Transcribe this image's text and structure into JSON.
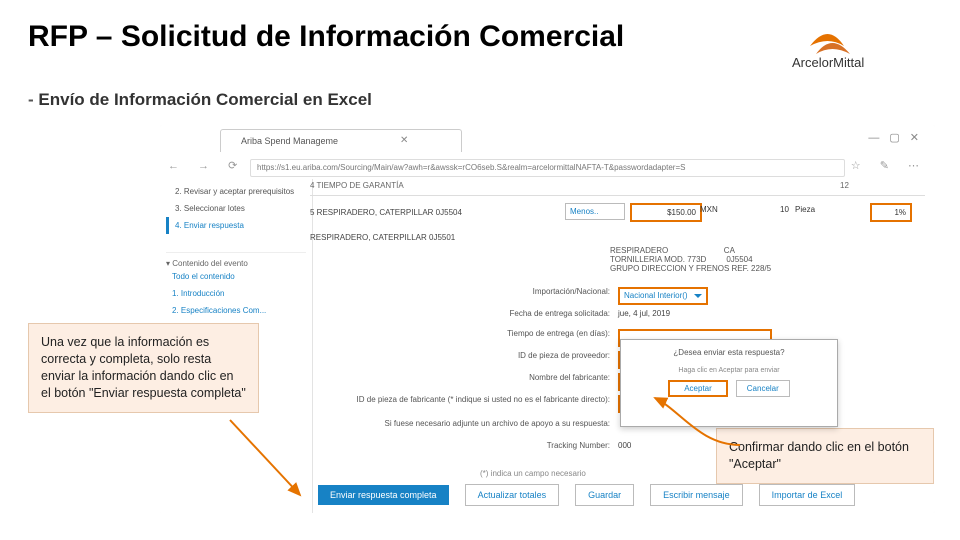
{
  "title": "RFP – Solicitud de Información Comercial",
  "subtitle_prefix": "- ",
  "subtitle": "Envío de Información Comercial en Excel",
  "logo_text": "ArcelorMittal",
  "browser": {
    "tab": "Ariba Spend Manageme",
    "url": "https://s1.eu.ariba.com/Sourcing/Main/aw?awh=r&awssk=rCO6seb.S&realm=arcelormittalNAFTA-T&passwordadapter=S",
    "win_minimize": "—",
    "win_restore": "▢",
    "win_close": "✕"
  },
  "sidebar": {
    "steps": [
      "2.  Revisar y aceptar prerequisitos",
      "3.  Seleccionar lotes",
      "4.  Enviar respuesta"
    ],
    "section": "▾ Contenido del evento",
    "links": [
      "Todo el contenido",
      "1. Introducción",
      "2. Especificaciones Com..."
    ]
  },
  "main": {
    "head_col": "4   TIEMPO DE GARANTÍA",
    "head_val": "12",
    "item_no": "5  RESPIRADERO, CATERPILLAR 0J5504",
    "menos": "Menos..",
    "price": "$150.00",
    "ccy": "MXN",
    "qty": "10",
    "unit": "Pieza",
    "pct": "1%",
    "desc_title": "RESPIRADERO, CATERPILLAR 0J5501",
    "desc_lines": "RESPIRADERO                         CA\nTORNILLERIA MOD. 773D         0J5504\nGRUPO DIRECCION Y FRENOS REF. 228/5",
    "rows": [
      {
        "lbl": "Importación/Nacional:",
        "val": "Nacional Interior()",
        "type": "select"
      },
      {
        "lbl": "Fecha de entrega solicitada:",
        "val": "jue, 4 jul, 2019",
        "type": "text"
      },
      {
        "lbl": "Tiempo de entrega (en días):",
        "val": "",
        "type": "box"
      },
      {
        "lbl": "ID de pieza de proveedor:",
        "val": "",
        "type": "box"
      },
      {
        "lbl": "Nombre del fabricante:",
        "val": "",
        "type": "box"
      },
      {
        "lbl": "ID de pieza de fabricante (* indique si usted no es el fabricante directo):",
        "val": "",
        "type": "box"
      },
      {
        "lbl": "Si fuese necesario adjunte un archivo de apoyo a su respuesta:",
        "val": "",
        "type": "text"
      },
      {
        "lbl": "Tracking Number:",
        "val": "000",
        "type": "text"
      }
    ],
    "asterisk": "(*) indica un campo necesario"
  },
  "dialog": {
    "question": "¿Desea enviar esta respuesta?",
    "hint": "Haga clic en Aceptar para enviar",
    "accept": "Aceptar",
    "cancel": "Cancelar"
  },
  "buttons": {
    "submit": "Enviar respuesta completa",
    "update": "Actualizar totales",
    "save": "Guardar",
    "msg": "Escribir mensaje",
    "import": "Importar de Excel"
  },
  "callouts": {
    "left": "Una vez que la información es correcta y completa, solo resta enviar la información dando clic en el botón \"Enviar respuesta completa\"",
    "right": "Confirmar dando clic en el botón \"Aceptar\""
  }
}
